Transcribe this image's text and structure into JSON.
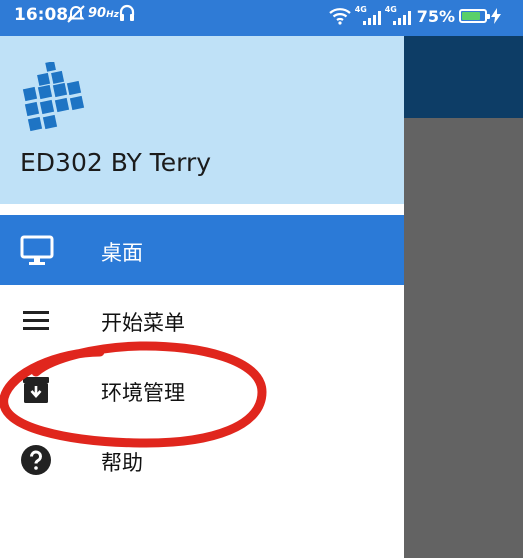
{
  "status_bar": {
    "time": "16:08",
    "refresh_rate": "90",
    "refresh_unit": "Hz",
    "signal_1_tag": "4G",
    "signal_2_tag": "4G",
    "battery_percent": "75%"
  },
  "drawer": {
    "header_title": "ED302 BY Terry",
    "items": [
      {
        "label": "桌面",
        "icon": "monitor-icon",
        "selected": true
      },
      {
        "label": "开始菜单",
        "icon": "menu-icon",
        "selected": false
      },
      {
        "label": "环境管理",
        "icon": "archive-download-icon",
        "selected": false
      },
      {
        "label": "帮助",
        "icon": "help-circle-icon",
        "selected": false
      }
    ]
  },
  "colors": {
    "status_bar": "#2f7bd6",
    "header_bg": "#bfe1f7",
    "selected_item": "#2b7ad7",
    "annotation_circle": "#e0261d",
    "scrim": "#636363"
  }
}
